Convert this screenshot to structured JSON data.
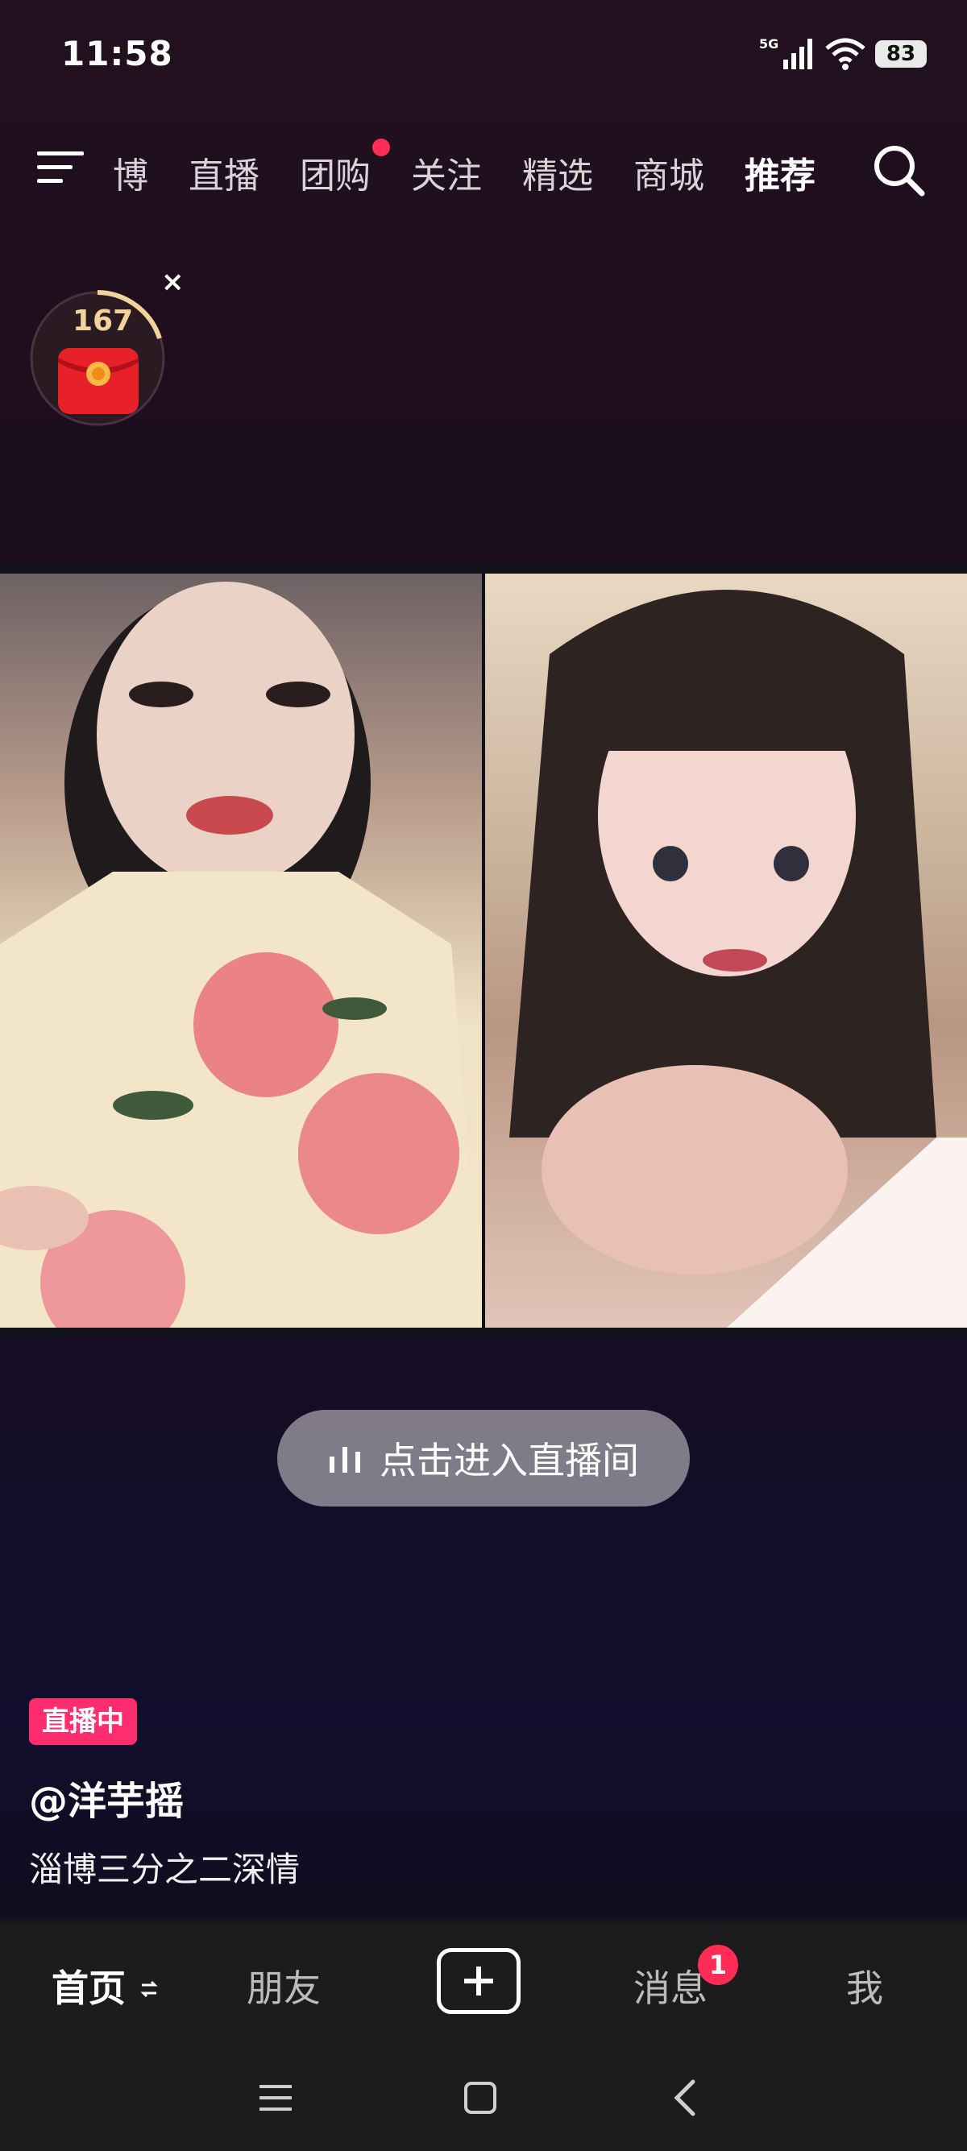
{
  "status_bar": {
    "time": "11:58",
    "network": "5G",
    "battery": "83"
  },
  "top_nav": {
    "tabs": [
      {
        "label": "博",
        "partial": true
      },
      {
        "label": "直播"
      },
      {
        "label": "团购",
        "has_dot": true
      },
      {
        "label": "关注"
      },
      {
        "label": "精选"
      },
      {
        "label": "商城"
      },
      {
        "label": "推荐",
        "active": true
      }
    ]
  },
  "red_packet": {
    "count": "167"
  },
  "live_call": {
    "enter_label": "点击进入直播间"
  },
  "stream": {
    "live_badge": "直播中",
    "username": "@洋芋摇",
    "description": "淄博三分之二深情"
  },
  "bottom_nav": {
    "items": [
      {
        "label": "首页",
        "active": true
      },
      {
        "label": "朋友"
      },
      {
        "label": "消息",
        "badge": "1"
      },
      {
        "label": "我"
      }
    ]
  },
  "colors": {
    "accent_pink": "#ff2d6f",
    "badge_red": "#ff2c55"
  }
}
